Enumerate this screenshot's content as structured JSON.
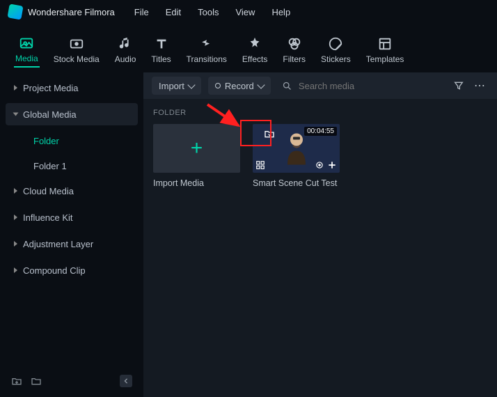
{
  "app": {
    "title": "Wondershare Filmora"
  },
  "menubar": [
    "File",
    "Edit",
    "Tools",
    "View",
    "Help"
  ],
  "tooltabs": [
    {
      "label": "Media",
      "active": true
    },
    {
      "label": "Stock Media"
    },
    {
      "label": "Audio"
    },
    {
      "label": "Titles"
    },
    {
      "label": "Transitions"
    },
    {
      "label": "Effects"
    },
    {
      "label": "Filters"
    },
    {
      "label": "Stickers"
    },
    {
      "label": "Templates"
    }
  ],
  "sidebar": {
    "items": [
      {
        "label": "Project Media",
        "expanded": false
      },
      {
        "label": "Global Media",
        "expanded": true,
        "children": [
          {
            "label": "Folder",
            "selected": true
          },
          {
            "label": "Folder 1"
          }
        ]
      },
      {
        "label": "Cloud Media"
      },
      {
        "label": "Influence Kit"
      },
      {
        "label": "Adjustment Layer"
      },
      {
        "label": "Compound Clip"
      }
    ]
  },
  "toolbar": {
    "import_label": "Import",
    "record_label": "Record",
    "search_placeholder": "Search media"
  },
  "content": {
    "section_label": "FOLDER",
    "cards": [
      {
        "label": "Import Media",
        "type": "add"
      },
      {
        "label": "Smart Scene Cut Test",
        "type": "video",
        "duration": "00:04:55"
      }
    ]
  }
}
